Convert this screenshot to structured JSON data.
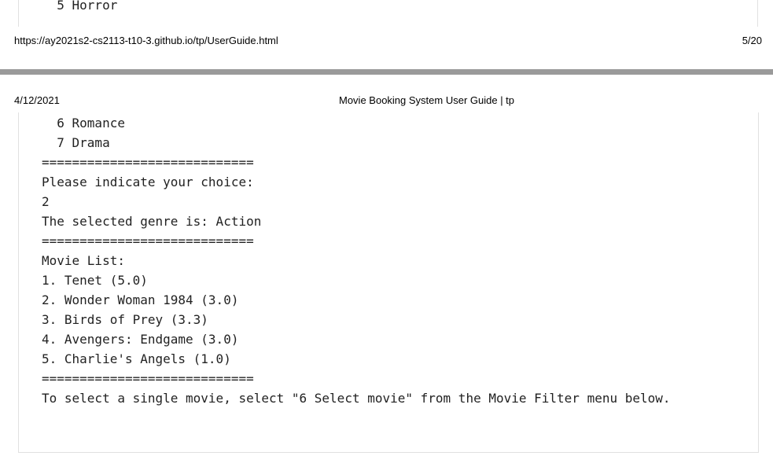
{
  "previous_page": {
    "code_line": "  5 Horror",
    "footer_url": "https://ay2021s2-cs2113-t10-3.github.io/tp/UserGuide.html",
    "footer_page": "5/20"
  },
  "current_page": {
    "header_date": "4/12/2021",
    "header_title": "Movie Booking System User Guide | tp",
    "code_lines": [
      "  6 Romance",
      "  7 Drama",
      "============================",
      "Please indicate your choice:",
      "2",
      "The selected genre is: Action",
      "",
      "============================",
      "Movie List:",
      "1. Tenet (5.0)",
      "2. Wonder Woman 1984 (3.0)",
      "3. Birds of Prey (3.3)",
      "4. Avengers: Endgame (3.0)",
      "5. Charlie's Angels (1.0)",
      "============================",
      "To select a single movie, select \"6 Select movie\" from the Movie Filter menu below."
    ]
  }
}
